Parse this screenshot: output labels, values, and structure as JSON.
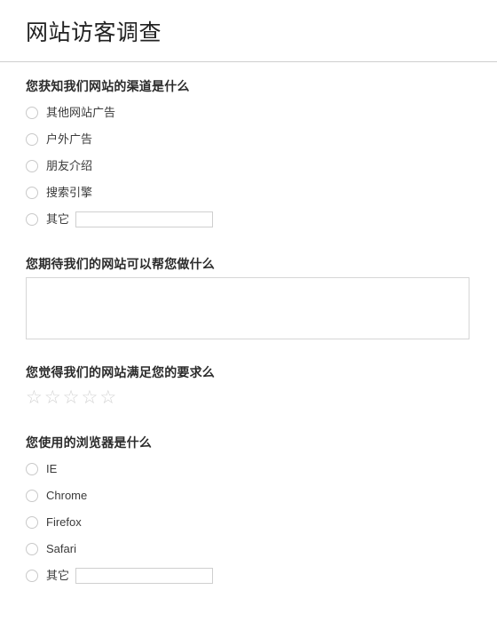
{
  "header": {
    "title": "网站访客调查"
  },
  "questions": [
    {
      "id": "referral-source",
      "title": "您获知我们网站的渠道是什么",
      "type": "radio",
      "options": [
        {
          "label": "其他网站广告",
          "has_input": false
        },
        {
          "label": "户外广告",
          "has_input": false
        },
        {
          "label": "朋友介绍",
          "has_input": false
        },
        {
          "label": "搜索引擎",
          "has_input": false
        },
        {
          "label": "其它",
          "has_input": true,
          "input_value": "",
          "input_placeholder": ""
        }
      ]
    },
    {
      "id": "expectations",
      "title": "您期待我们的网站可以帮您做什么",
      "type": "textarea",
      "value": "",
      "placeholder": ""
    },
    {
      "id": "satisfaction",
      "title": "您觉得我们的网站满足您的要求么",
      "type": "rating",
      "max_stars": 5,
      "selected": 0,
      "star_glyph": "★",
      "empty_star_glyph": "☆",
      "empty_color": "#d2d2d2"
    },
    {
      "id": "browser",
      "title": "您使用的浏览器是什么",
      "type": "radio",
      "options": [
        {
          "label": "IE",
          "has_input": false
        },
        {
          "label": "Chrome",
          "has_input": false
        },
        {
          "label": "Firefox",
          "has_input": false
        },
        {
          "label": "Safari",
          "has_input": false
        },
        {
          "label": "其它",
          "has_input": true,
          "input_value": "",
          "input_placeholder": ""
        }
      ]
    }
  ],
  "colors": {
    "text": "#333333",
    "title": "#222222",
    "divider": "#cfcfcf",
    "border": "#cfcfcf",
    "star_empty": "#d2d2d2",
    "background": "#ffffff"
  }
}
